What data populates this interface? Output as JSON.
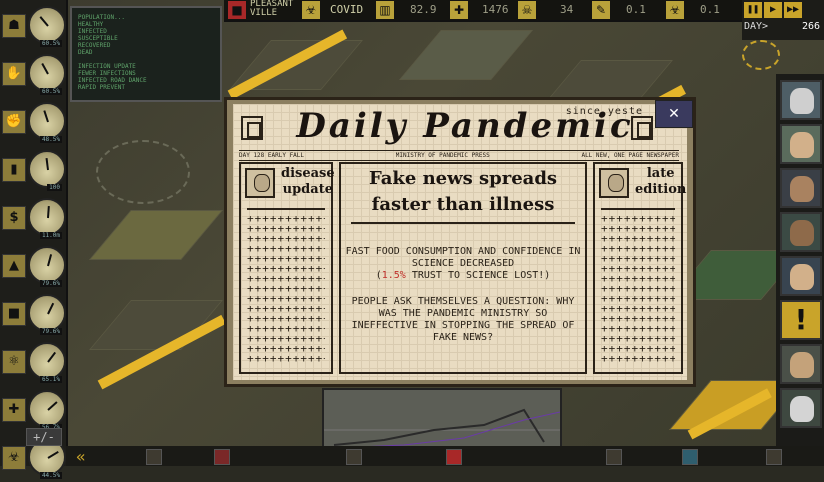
{
  "topbar": {
    "city": "PLEASANT\nVILLE",
    "disease": "COVID",
    "infection_value": "82.9",
    "cases_value": "1476",
    "deaths_value": "34",
    "vaccine_value": "0.1",
    "days_value": "0.1"
  },
  "speed": {
    "day_label": "DAY>",
    "day_value": "266"
  },
  "stats_panel": {
    "lines": [
      "POPULATION...",
      "HEALTHY",
      "INFECTED",
      "SUSCEPTIBLE",
      "RECOVERED",
      "DEAD",
      "",
      "INFECTION UPDATE",
      "FEWER INFECTIONS",
      "INFECTED ROAD DANCE",
      "RAPID PREVENT"
    ]
  },
  "gauges": [
    {
      "icon": "mask-icon",
      "glyph": "☗",
      "value": "60.5%"
    },
    {
      "icon": "hand-icon",
      "glyph": "✋",
      "value": "60.5%"
    },
    {
      "icon": "fist-icon",
      "glyph": "✊",
      "value": "48.5%"
    },
    {
      "icon": "pill-icon",
      "glyph": "▮",
      "value": "100"
    },
    {
      "icon": "money-icon",
      "glyph": "$",
      "value": "11.0m"
    },
    {
      "icon": "hat-icon",
      "glyph": "▲",
      "value": "79.6%"
    },
    {
      "icon": "box-icon",
      "glyph": "■",
      "value": "79.6%"
    },
    {
      "icon": "atom-icon",
      "glyph": "⚛",
      "value": "65.1%"
    },
    {
      "icon": "medical-cross-icon",
      "glyph": "✚",
      "value": "56.7%"
    },
    {
      "icon": "biohazard-icon",
      "glyph": "☣",
      "value": "44.5%"
    }
  ],
  "plusminus": "+/-",
  "newspaper": {
    "masthead": "Daily Pandemic",
    "since": "since yeste",
    "subline_left": "DAY 128 EARLY FALL",
    "subline_mid": "MINISTRY OF PANDEMIC PRESS",
    "subline_right": "ALL NEW, ONE PAGE NEWSPAPER",
    "close": "✕",
    "left_head": "disease\nupdate",
    "right_head": "late\nedition",
    "headline": "Fake news spreads\nfaster than illness",
    "story_p1_a": "FAST FOOD CONSUMPTION AND CONFIDENCE IN SCIENCE DECREASED",
    "story_p1_open": "(",
    "story_p1_hl": "1.5%",
    "story_p1_b": " TRUST TO SCIENCE LOST!)",
    "story_p2": "PEOPLE ASK THEMSELVES A QUESTION: WHY WAS THE PANDEMIC MINISTRY SO INEFFECTIVE IN STOPPING THE SPREAD OF FAKE NEWS?",
    "cross_pattern": "++++++++++++++++"
  },
  "bottombar": {
    "arrow": "«"
  },
  "colors": {
    "accent": "#c9a42a",
    "paper": "#e9dcc2",
    "highlight": "#c0302a"
  }
}
